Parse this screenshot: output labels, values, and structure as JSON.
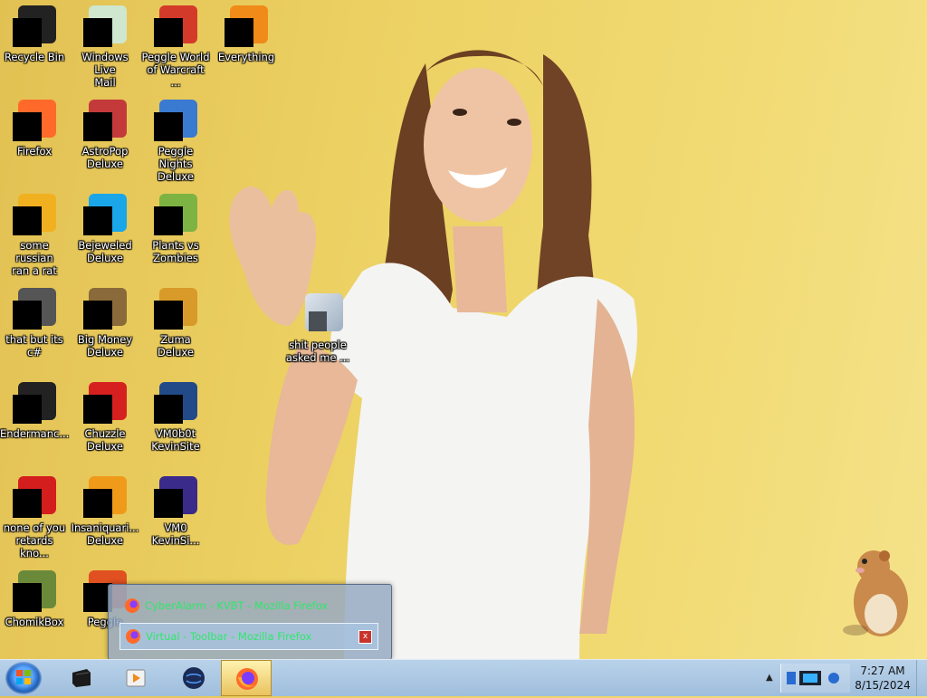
{
  "desktop": {
    "icons": [
      {
        "label": "Recycle Bin",
        "name": "recycle-bin-icon"
      },
      {
        "label": "Windows Live\nMail",
        "name": "windows-live-mail-icon"
      },
      {
        "label": "Peggle World\nof Warcraft ...",
        "name": "peggle-wow-icon"
      },
      {
        "label": "Everything",
        "name": "everything-icon"
      },
      {
        "label": "Firefox",
        "name": "firefox-icon"
      },
      {
        "label": "AstroPop\nDeluxe",
        "name": "astropop-icon"
      },
      {
        "label": "Peggle Nights\nDeluxe",
        "name": "peggle-nights-icon"
      },
      {
        "label": "some russian\nran a rat",
        "name": "russian-rat-icon"
      },
      {
        "label": "Bejeweled\nDeluxe",
        "name": "bejeweled-icon"
      },
      {
        "label": "Plants vs\nZombies",
        "name": "plants-vs-zombies-icon"
      },
      {
        "label": "that but its c#",
        "name": "csharp-folder-icon"
      },
      {
        "label": "Big Money\nDeluxe",
        "name": "big-money-icon"
      },
      {
        "label": "Zuma Deluxe",
        "name": "zuma-icon"
      },
      {
        "label": "Endermanc...",
        "name": "endermanch-icon"
      },
      {
        "label": "Chuzzle\nDeluxe",
        "name": "chuzzle-icon"
      },
      {
        "label": "VM0b0t\nKevinSite",
        "name": "vm0b0t-icon"
      },
      {
        "label": "none of you\nretards kno...",
        "name": "none-of-you-icon"
      },
      {
        "label": "Insaniquari...\nDeluxe",
        "name": "insaniquarium-icon"
      },
      {
        "label": "VM0\nKevinSi...",
        "name": "vm0-kevinsite-icon"
      },
      {
        "label": "ChomikBox",
        "name": "chomikbox-icon"
      },
      {
        "label": "Peggle",
        "name": "peggle-icon"
      },
      {
        "label": "shit people\nasked me ...",
        "name": "shit-people-folder-icon"
      }
    ]
  },
  "thumbnail_popup": {
    "items": [
      {
        "label": "CyberAlarm - KVBT - Mozilla Firefox"
      },
      {
        "label": "Virtual - Toolbar - Mozilla Firefox"
      }
    ],
    "close_symbol": "x"
  },
  "taskbar": {
    "pinned": [
      {
        "name": "taskbar-media-app-icon"
      },
      {
        "name": "taskbar-media-player-icon"
      },
      {
        "name": "taskbar-globe-icon"
      },
      {
        "name": "taskbar-firefox-icon"
      }
    ],
    "tray_arrow": "▲",
    "clock_time": "7:27 AM",
    "clock_date": "8/15/2024"
  },
  "colors": {
    "wallpaper": "#ecd062",
    "taskbar": "#b9d2ea",
    "thumb_text": "#2ee86b"
  }
}
